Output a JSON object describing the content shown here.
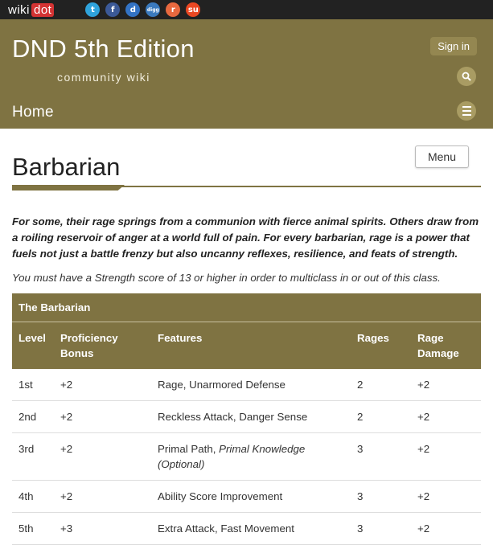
{
  "topbar": {
    "logo_prefix": "wiki",
    "logo_suffix": "dot",
    "socials": [
      {
        "name": "twitter-icon",
        "glyph": "t",
        "color": "#2fa3dc"
      },
      {
        "name": "facebook-icon",
        "glyph": "f",
        "color": "#3b5998"
      },
      {
        "name": "delicious-icon",
        "glyph": "d",
        "color": "#3373c5"
      },
      {
        "name": "digg-icon",
        "glyph": "digg",
        "color": "#3b7abe"
      },
      {
        "name": "reddit-icon",
        "glyph": "r",
        "color": "#e8693f"
      },
      {
        "name": "stumbleupon-icon",
        "glyph": "su",
        "color": "#eb4823"
      }
    ]
  },
  "header": {
    "title": "DND 5th Edition",
    "subtitle": "community wiki",
    "signin": "Sign in",
    "home": "Home",
    "search_icon": "search-icon",
    "menu_icon": "hamburger-icon"
  },
  "page": {
    "menu_button": "Menu",
    "title": "Barbarian",
    "intro": "For some, their rage springs from a communion with fierce animal spirits. Others draw from a roiling reservoir of anger at a world full of pain. For every barbarian, rage is a power that fuels not just a battle frenzy but also uncanny reflexes, resilience, and feats of strength.",
    "multiclass": "You must have a Strength score of 13 or higher in order to multiclass in or out of this class."
  },
  "table": {
    "caption": "The Barbarian",
    "headers": [
      "Level",
      "Proficiency Bonus",
      "Features",
      "Rages",
      "Rage Damage"
    ],
    "rows": [
      {
        "level": "1st",
        "prof": "+2",
        "features": "Rage, Unarmored Defense",
        "features_italic": "",
        "rages": "2",
        "damage": "+2"
      },
      {
        "level": "2nd",
        "prof": "+2",
        "features": "Reckless Attack, Danger Sense",
        "features_italic": "",
        "rages": "2",
        "damage": "+2"
      },
      {
        "level": "3rd",
        "prof": "+2",
        "features": "Primal Path, ",
        "features_italic": "Primal Knowledge (Optional)",
        "rages": "3",
        "damage": "+2"
      },
      {
        "level": "4th",
        "prof": "+2",
        "features": "Ability Score Improvement",
        "features_italic": "",
        "rages": "3",
        "damage": "+2"
      },
      {
        "level": "5th",
        "prof": "+3",
        "features": "Extra Attack, Fast Movement",
        "features_italic": "",
        "rages": "3",
        "damage": "+2"
      }
    ]
  },
  "colors": {
    "brand": "#7f7342",
    "topbar": "#222222",
    "logo_accent": "#d43333"
  }
}
